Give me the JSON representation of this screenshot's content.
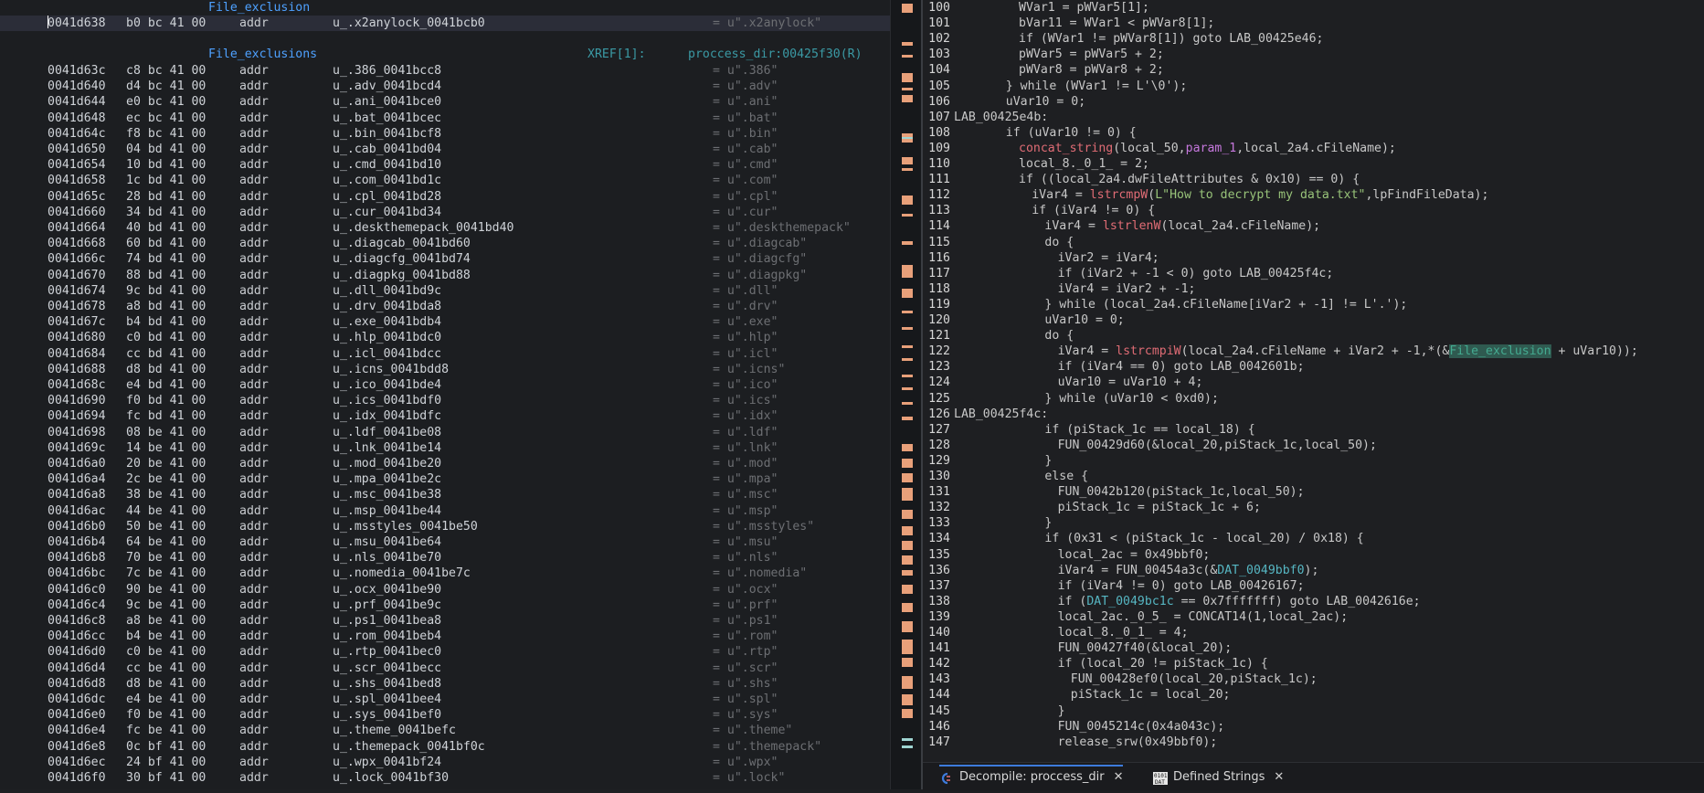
{
  "listing": {
    "top_label": "File_exclusion",
    "top_row": {
      "address": "0041d638",
      "bytes": "b0 bc 41 00",
      "mnemonic": "addr",
      "operand": "u_.x2anylock_0041bcb0",
      "comment": "= u\".x2anylock\""
    },
    "section_label": "File_exclusions",
    "xref_label": "XREF[1]:",
    "xref_target": "proccess_dir:00425f30(R)",
    "rows": [
      {
        "address": "0041d63c",
        "bytes": "c8 bc 41 00",
        "operand": "u_.386_0041bcc8",
        "comment": "= u\".386\""
      },
      {
        "address": "0041d640",
        "bytes": "d4 bc 41 00",
        "operand": "u_.adv_0041bcd4",
        "comment": "= u\".adv\""
      },
      {
        "address": "0041d644",
        "bytes": "e0 bc 41 00",
        "operand": "u_.ani_0041bce0",
        "comment": "= u\".ani\""
      },
      {
        "address": "0041d648",
        "bytes": "ec bc 41 00",
        "operand": "u_.bat_0041bcec",
        "comment": "= u\".bat\""
      },
      {
        "address": "0041d64c",
        "bytes": "f8 bc 41 00",
        "operand": "u_.bin_0041bcf8",
        "comment": "= u\".bin\""
      },
      {
        "address": "0041d650",
        "bytes": "04 bd 41 00",
        "operand": "u_.cab_0041bd04",
        "comment": "= u\".cab\""
      },
      {
        "address": "0041d654",
        "bytes": "10 bd 41 00",
        "operand": "u_.cmd_0041bd10",
        "comment": "= u\".cmd\""
      },
      {
        "address": "0041d658",
        "bytes": "1c bd 41 00",
        "operand": "u_.com_0041bd1c",
        "comment": "= u\".com\""
      },
      {
        "address": "0041d65c",
        "bytes": "28 bd 41 00",
        "operand": "u_.cpl_0041bd28",
        "comment": "= u\".cpl\""
      },
      {
        "address": "0041d660",
        "bytes": "34 bd 41 00",
        "operand": "u_.cur_0041bd34",
        "comment": "= u\".cur\""
      },
      {
        "address": "0041d664",
        "bytes": "40 bd 41 00",
        "operand": "u_.deskthemepack_0041bd40",
        "comment": "= u\".deskthemepack\""
      },
      {
        "address": "0041d668",
        "bytes": "60 bd 41 00",
        "operand": "u_.diagcab_0041bd60",
        "comment": "= u\".diagcab\""
      },
      {
        "address": "0041d66c",
        "bytes": "74 bd 41 00",
        "operand": "u_.diagcfg_0041bd74",
        "comment": "= u\".diagcfg\""
      },
      {
        "address": "0041d670",
        "bytes": "88 bd 41 00",
        "operand": "u_.diagpkg_0041bd88",
        "comment": "= u\".diagpkg\""
      },
      {
        "address": "0041d674",
        "bytes": "9c bd 41 00",
        "operand": "u_.dll_0041bd9c",
        "comment": "= u\".dll\""
      },
      {
        "address": "0041d678",
        "bytes": "a8 bd 41 00",
        "operand": "u_.drv_0041bda8",
        "comment": "= u\".drv\""
      },
      {
        "address": "0041d67c",
        "bytes": "b4 bd 41 00",
        "operand": "u_.exe_0041bdb4",
        "comment": "= u\".exe\""
      },
      {
        "address": "0041d680",
        "bytes": "c0 bd 41 00",
        "operand": "u_.hlp_0041bdc0",
        "comment": "= u\".hlp\""
      },
      {
        "address": "0041d684",
        "bytes": "cc bd 41 00",
        "operand": "u_.icl_0041bdcc",
        "comment": "= u\".icl\""
      },
      {
        "address": "0041d688",
        "bytes": "d8 bd 41 00",
        "operand": "u_.icns_0041bdd8",
        "comment": "= u\".icns\""
      },
      {
        "address": "0041d68c",
        "bytes": "e4 bd 41 00",
        "operand": "u_.ico_0041bde4",
        "comment": "= u\".ico\""
      },
      {
        "address": "0041d690",
        "bytes": "f0 bd 41 00",
        "operand": "u_.ics_0041bdf0",
        "comment": "= u\".ics\""
      },
      {
        "address": "0041d694",
        "bytes": "fc bd 41 00",
        "operand": "u_.idx_0041bdfc",
        "comment": "= u\".idx\""
      },
      {
        "address": "0041d698",
        "bytes": "08 be 41 00",
        "operand": "u_.ldf_0041be08",
        "comment": "= u\".ldf\""
      },
      {
        "address": "0041d69c",
        "bytes": "14 be 41 00",
        "operand": "u_.lnk_0041be14",
        "comment": "= u\".lnk\""
      },
      {
        "address": "0041d6a0",
        "bytes": "20 be 41 00",
        "operand": "u_.mod_0041be20",
        "comment": "= u\".mod\""
      },
      {
        "address": "0041d6a4",
        "bytes": "2c be 41 00",
        "operand": "u_.mpa_0041be2c",
        "comment": "= u\".mpa\""
      },
      {
        "address": "0041d6a8",
        "bytes": "38 be 41 00",
        "operand": "u_.msc_0041be38",
        "comment": "= u\".msc\""
      },
      {
        "address": "0041d6ac",
        "bytes": "44 be 41 00",
        "operand": "u_.msp_0041be44",
        "comment": "= u\".msp\""
      },
      {
        "address": "0041d6b0",
        "bytes": "50 be 41 00",
        "operand": "u_.msstyles_0041be50",
        "comment": "= u\".msstyles\""
      },
      {
        "address": "0041d6b4",
        "bytes": "64 be 41 00",
        "operand": "u_.msu_0041be64",
        "comment": "= u\".msu\""
      },
      {
        "address": "0041d6b8",
        "bytes": "70 be 41 00",
        "operand": "u_.nls_0041be70",
        "comment": "= u\".nls\""
      },
      {
        "address": "0041d6bc",
        "bytes": "7c be 41 00",
        "operand": "u_.nomedia_0041be7c",
        "comment": "= u\".nomedia\""
      },
      {
        "address": "0041d6c0",
        "bytes": "90 be 41 00",
        "operand": "u_.ocx_0041be90",
        "comment": "= u\".ocx\""
      },
      {
        "address": "0041d6c4",
        "bytes": "9c be 41 00",
        "operand": "u_.prf_0041be9c",
        "comment": "= u\".prf\""
      },
      {
        "address": "0041d6c8",
        "bytes": "a8 be 41 00",
        "operand": "u_.ps1_0041bea8",
        "comment": "= u\".ps1\""
      },
      {
        "address": "0041d6cc",
        "bytes": "b4 be 41 00",
        "operand": "u_.rom_0041beb4",
        "comment": "= u\".rom\""
      },
      {
        "address": "0041d6d0",
        "bytes": "c0 be 41 00",
        "operand": "u_.rtp_0041bec0",
        "comment": "= u\".rtp\""
      },
      {
        "address": "0041d6d4",
        "bytes": "cc be 41 00",
        "operand": "u_.scr_0041becc",
        "comment": "= u\".scr\""
      },
      {
        "address": "0041d6d8",
        "bytes": "d8 be 41 00",
        "operand": "u_.shs_0041bed8",
        "comment": "= u\".shs\""
      },
      {
        "address": "0041d6dc",
        "bytes": "e4 be 41 00",
        "operand": "u_.spl_0041bee4",
        "comment": "= u\".spl\""
      },
      {
        "address": "0041d6e0",
        "bytes": "f0 be 41 00",
        "operand": "u_.sys_0041bef0",
        "comment": "= u\".sys\""
      },
      {
        "address": "0041d6e4",
        "bytes": "fc be 41 00",
        "operand": "u_.theme_0041befc",
        "comment": "= u\".theme\""
      },
      {
        "address": "0041d6e8",
        "bytes": "0c bf 41 00",
        "operand": "u_.themepack_0041bf0c",
        "comment": "= u\".themepack\""
      },
      {
        "address": "0041d6ec",
        "bytes": "24 bf 41 00",
        "operand": "u_.wpx_0041bf24",
        "comment": "= u\".wpx\""
      },
      {
        "address": "0041d6f0",
        "bytes": "30 bf 41 00",
        "operand": "u_.lock_0041bf30",
        "comment": "= u\".lock\""
      }
    ],
    "mnemonic": "addr"
  },
  "decompile": {
    "lines": [
      {
        "n": "100",
        "indent": 5,
        "text": "WVar1 = pWVar5[1];"
      },
      {
        "n": "101",
        "indent": 5,
        "text": "bVar11 = WVar1 < pWVar8[1];"
      },
      {
        "n": "102",
        "indent": 5,
        "text": "if (WVar1 != pWVar8[1]) goto LAB_00425e46;"
      },
      {
        "n": "103",
        "indent": 5,
        "text": "pWVar5 = pWVar5 + 2;"
      },
      {
        "n": "104",
        "indent": 5,
        "text": "pWVar8 = pWVar8 + 2;"
      },
      {
        "n": "105",
        "indent": 4,
        "text": "} while (WVar1 != L'\\0');"
      },
      {
        "n": "106",
        "indent": 4,
        "text": "uVar10 = 0;"
      },
      {
        "n": "107",
        "indent": 0,
        "text": "LAB_00425e4b:"
      },
      {
        "n": "108",
        "indent": 4,
        "text": "if (uVar10 != 0) {"
      },
      {
        "n": "109",
        "indent": 5,
        "text": "concat_string(local_50,param_1,local_2a4.cFileName);"
      },
      {
        "n": "110",
        "indent": 5,
        "text": "local_8._0_1_ = 2;"
      },
      {
        "n": "111",
        "indent": 5,
        "text": "if ((local_2a4.dwFileAttributes & 0x10) == 0) {"
      },
      {
        "n": "112",
        "indent": 6,
        "text": "iVar4 = lstrcmpW(L\"How to decrypt my data.txt\",lpFindFileData);"
      },
      {
        "n": "113",
        "indent": 6,
        "text": "if (iVar4 != 0) {"
      },
      {
        "n": "114",
        "indent": 7,
        "text": "iVar4 = lstrlenW(local_2a4.cFileName);"
      },
      {
        "n": "115",
        "indent": 7,
        "text": "do {"
      },
      {
        "n": "116",
        "indent": 8,
        "text": "iVar2 = iVar4;"
      },
      {
        "n": "117",
        "indent": 8,
        "text": "if (iVar2 + -1 < 0) goto LAB_00425f4c;"
      },
      {
        "n": "118",
        "indent": 8,
        "text": "iVar4 = iVar2 + -1;"
      },
      {
        "n": "119",
        "indent": 7,
        "text": "} while (local_2a4.cFileName[iVar2 + -1] != L'.');"
      },
      {
        "n": "120",
        "indent": 7,
        "text": "uVar10 = 0;"
      },
      {
        "n": "121",
        "indent": 7,
        "text": "do {"
      },
      {
        "n": "122",
        "indent": 8,
        "text": "iVar4 = lstrcmpiW(local_2a4.cFileName + iVar2 + -1,*(&File_exclusion + uVar10));"
      },
      {
        "n": "123",
        "indent": 8,
        "text": "if (iVar4 == 0) goto LAB_0042601b;"
      },
      {
        "n": "124",
        "indent": 8,
        "text": "uVar10 = uVar10 + 4;"
      },
      {
        "n": "125",
        "indent": 7,
        "text": "} while (uVar10 < 0xd0);"
      },
      {
        "n": "126",
        "indent": 0,
        "text": "LAB_00425f4c:"
      },
      {
        "n": "127",
        "indent": 7,
        "text": "if (piStack_1c == local_18) {"
      },
      {
        "n": "128",
        "indent": 8,
        "text": "FUN_00429d60(&local_20,piStack_1c,local_50);"
      },
      {
        "n": "129",
        "indent": 7,
        "text": "}"
      },
      {
        "n": "130",
        "indent": 7,
        "text": "else {"
      },
      {
        "n": "131",
        "indent": 8,
        "text": "FUN_0042b120(piStack_1c,local_50);"
      },
      {
        "n": "132",
        "indent": 8,
        "text": "piStack_1c = piStack_1c + 6;"
      },
      {
        "n": "133",
        "indent": 7,
        "text": "}"
      },
      {
        "n": "134",
        "indent": 7,
        "text": "if (0x31 < (piStack_1c - local_20) / 0x18) {"
      },
      {
        "n": "135",
        "indent": 8,
        "text": "local_2ac = 0x49bbf0;"
      },
      {
        "n": "136",
        "indent": 8,
        "text": "iVar4 = FUN_00454a3c(&DAT_0049bbf0);"
      },
      {
        "n": "137",
        "indent": 8,
        "text": "if (iVar4 != 0) goto LAB_00426167;"
      },
      {
        "n": "138",
        "indent": 8,
        "text": "if (DAT_0049bc1c == 0x7fffffff) goto LAB_0042616e;"
      },
      {
        "n": "139",
        "indent": 8,
        "text": "local_2ac._0_5_ = CONCAT14(1,local_2ac);"
      },
      {
        "n": "140",
        "indent": 8,
        "text": "local_8._0_1_ = 4;"
      },
      {
        "n": "141",
        "indent": 8,
        "text": "FUN_00427f40(&local_20);"
      },
      {
        "n": "142",
        "indent": 8,
        "text": "if (local_20 != piStack_1c) {"
      },
      {
        "n": "143",
        "indent": 9,
        "text": "FUN_00428ef0(local_20,piStack_1c);"
      },
      {
        "n": "144",
        "indent": 9,
        "text": "piStack_1c = local_20;"
      },
      {
        "n": "145",
        "indent": 8,
        "text": "}"
      },
      {
        "n": "146",
        "indent": 8,
        "text": "FUN_0045214c(0x4a043c);"
      },
      {
        "n": "147",
        "indent": 8,
        "text": "release_srw(0x49bbf0);"
      }
    ]
  },
  "tabs": [
    {
      "label": "Decompile: proccess_dir",
      "icon": "decompile-icon",
      "active": true
    },
    {
      "label": "Defined Strings",
      "icon": "data-icon",
      "active": false
    }
  ],
  "colors": {
    "accent": "#3d7bdc",
    "label": "#4ea1ff",
    "function": "#e06c75",
    "param": "#c678dd",
    "data": "#56b6c2",
    "string": "#98c379"
  }
}
